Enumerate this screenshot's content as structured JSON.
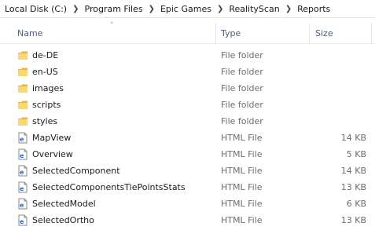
{
  "breadcrumb": [
    "Local Disk (C:)",
    "Program Files",
    "Epic Games",
    "RealityScan",
    "Reports"
  ],
  "columns": {
    "name": "Name",
    "type": "Type",
    "size": "Size"
  },
  "files": [
    {
      "name": "de-DE",
      "type": "File folder",
      "size": "",
      "icon": "folder-icon"
    },
    {
      "name": "en-US",
      "type": "File folder",
      "size": "",
      "icon": "folder-icon"
    },
    {
      "name": "images",
      "type": "File folder",
      "size": "",
      "icon": "folder-icon"
    },
    {
      "name": "scripts",
      "type": "File folder",
      "size": "",
      "icon": "folder-icon"
    },
    {
      "name": "styles",
      "type": "File folder",
      "size": "",
      "icon": "folder-icon"
    },
    {
      "name": "MapView",
      "type": "HTML File",
      "size": "14 KB",
      "icon": "html-file-icon"
    },
    {
      "name": "Overview",
      "type": "HTML File",
      "size": "5 KB",
      "icon": "html-file-icon"
    },
    {
      "name": "SelectedComponent",
      "type": "HTML File",
      "size": "14 KB",
      "icon": "html-file-icon"
    },
    {
      "name": "SelectedComponentsTiePointsStats",
      "type": "HTML File",
      "size": "13 KB",
      "icon": "html-file-icon"
    },
    {
      "name": "SelectedModel",
      "type": "HTML File",
      "size": "6 KB",
      "icon": "html-file-icon"
    },
    {
      "name": "SelectedOrtho",
      "type": "HTML File",
      "size": "13 KB",
      "icon": "html-file-icon"
    }
  ]
}
